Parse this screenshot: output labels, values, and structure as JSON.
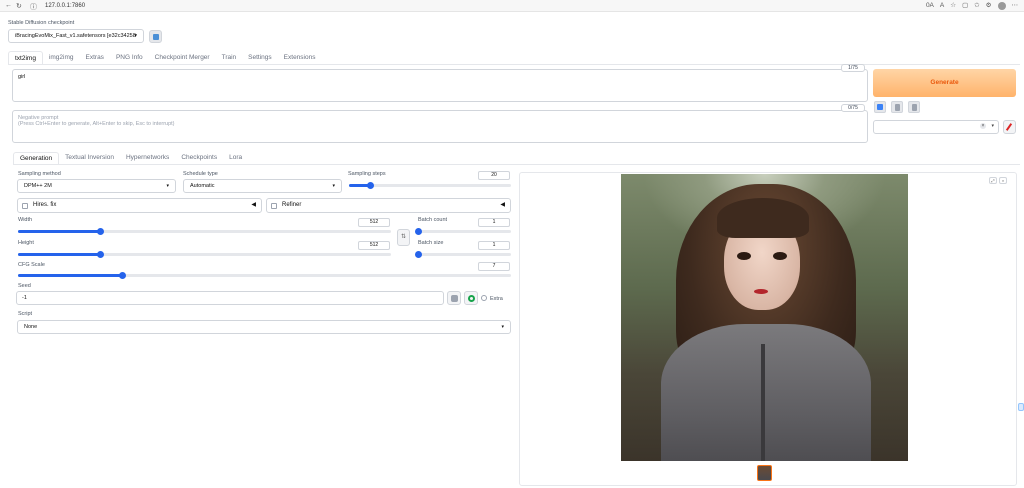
{
  "browser": {
    "url": "127.0.0.1:7860",
    "zoom_label": "0A"
  },
  "checkpoint": {
    "label": "Stable Diffusion checkpoint",
    "value": "iBracingEvoMix_Fast_v1.safetensors [e32c34258"
  },
  "main_tabs": [
    "txt2img",
    "img2img",
    "Extras",
    "PNG Info",
    "Checkpoint Merger",
    "Train",
    "Settings",
    "Extensions"
  ],
  "prompt": {
    "value": "girl",
    "count": "1/75"
  },
  "negative": {
    "placeholder_title": "Negative prompt",
    "placeholder_hint": "(Press Ctrl+Enter to generate, Alt+Enter to skip, Esc to interrupt)",
    "count": "0/75"
  },
  "generate_label": "Generate",
  "sub_tabs": [
    "Generation",
    "Textual Inversion",
    "Hypernetworks",
    "Checkpoints",
    "Lora"
  ],
  "sampling_method": {
    "label": "Sampling method",
    "value": "DPM++ 2M"
  },
  "schedule_type": {
    "label": "Schedule type",
    "value": "Automatic"
  },
  "sampling_steps": {
    "label": "Sampling steps",
    "value": "20",
    "fraction": 0.13
  },
  "hires": {
    "label": "Hires. fix"
  },
  "refiner": {
    "label": "Refiner"
  },
  "width": {
    "label": "Width",
    "value": "512",
    "fraction": 0.22
  },
  "height": {
    "label": "Height",
    "value": "512",
    "fraction": 0.22
  },
  "batch_count": {
    "label": "Batch count",
    "value": "1",
    "fraction": 0.0
  },
  "batch_size": {
    "label": "Batch size",
    "value": "1",
    "fraction": 0.0
  },
  "cfg_scale": {
    "label": "CFG Scale",
    "value": "7",
    "fraction": 0.21
  },
  "seed": {
    "label": "Seed",
    "value": "-1"
  },
  "extra_label": "Extra",
  "script": {
    "label": "Script",
    "value": "None"
  },
  "colors": {
    "accent": "#2563eb",
    "generate": "#ea580c"
  }
}
